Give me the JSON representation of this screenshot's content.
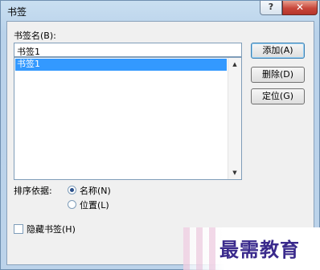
{
  "window": {
    "title": "书签",
    "help": "?",
    "close": "✕"
  },
  "bookmark": {
    "name_label": "书签名(B):",
    "name_value": "书签1",
    "list_items": [
      "书签1"
    ]
  },
  "buttons": {
    "add": "添加(A)",
    "delete": "删除(D)",
    "goto": "定位(G)"
  },
  "sort": {
    "label": "排序依据:",
    "by_name": "名称(N)",
    "by_position": "位置(L)",
    "selected": "by_name"
  },
  "hidden_bookmarks": {
    "label": "隐藏书签(H)",
    "checked": false
  },
  "scroll": {
    "up": "▲",
    "down": "▼"
  },
  "watermark": {
    "text": "最需教育"
  }
}
